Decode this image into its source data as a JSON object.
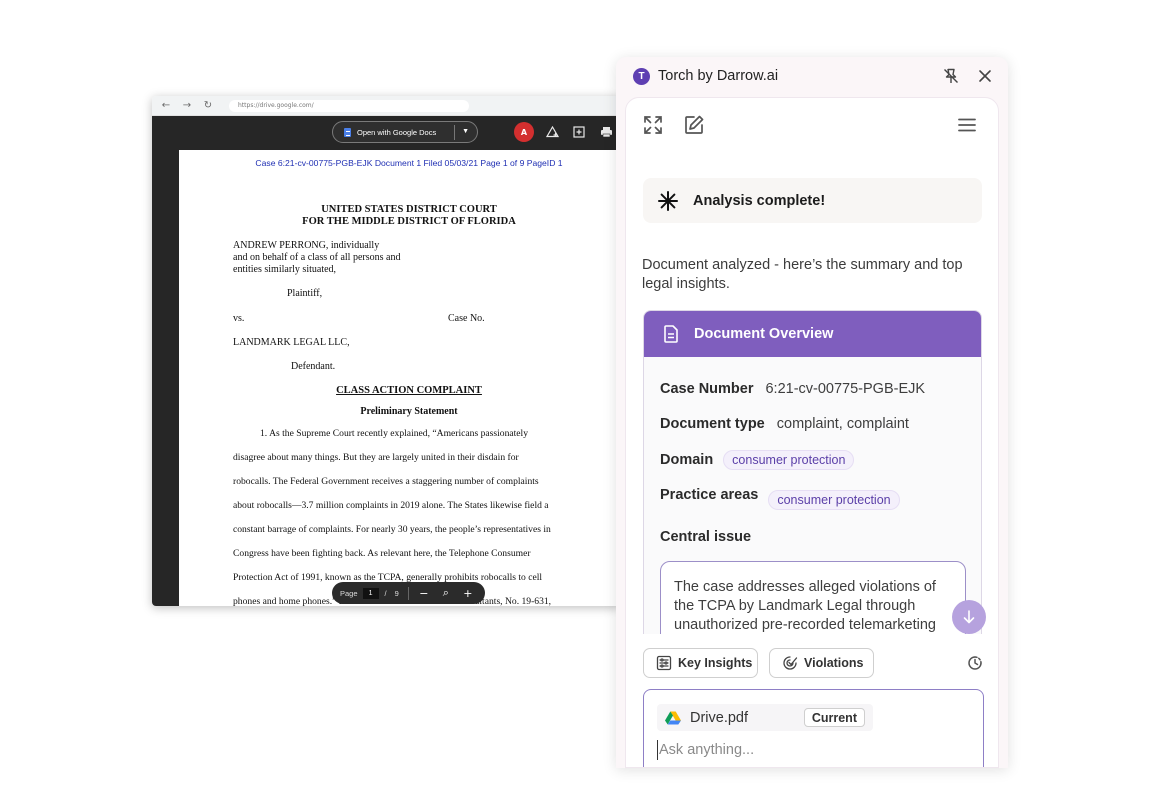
{
  "browser": {
    "url": "https://drive.google.com/",
    "nav": {
      "back": "←",
      "forward": "→",
      "reload": "↻"
    },
    "open_with_label": "Open with Google Docs"
  },
  "pdf": {
    "header_line": "Case 6:21-cv-00775-PGB-EJK   Document 1   Filed 05/03/21   Page 1 of 9 PageID 1",
    "court_line1": "UNITED STATES DISTRICT COURT",
    "court_line2": "FOR THE MIDDLE DISTRICT OF FLORIDA",
    "plaintiff_lines": [
      "ANDREW PERRONG, individually",
      "and on behalf of a class of all persons and",
      "entities similarly situated,"
    ],
    "plaintiff_label": "Plaintiff,",
    "vs": "vs.",
    "case_no": "Case No.",
    "defendant_name": "LANDMARK LEGAL LLC,",
    "defendant_label": "Defendant.",
    "complaint_title": "CLASS ACTION COMPLAINT",
    "prelim_title": "Preliminary Statement",
    "body_lines": [
      "1.       As the Supreme Court recently explained, “Americans passionately",
      "disagree about many things. But they are largely united in their disdain for",
      "robocalls. The Federal Government receives a staggering number of complaints",
      "about robocalls—3.7 million complaints in 2019 alone. The States likewise field a",
      "constant barrage of complaints. For nearly 30 years, the people’s representatives in",
      "Congress have been fighting back. As relevant here, the Telephone Consumer",
      "Protection Act of 1991, known as the TCPA, generally prohibits robocalls to cell",
      "phones and home phones.” Barr v. Am. Ass’n of Political Consultants, No. 19-631,"
    ],
    "pager": {
      "label": "Page",
      "current": "1",
      "slash": "/",
      "total": "9",
      "minus": "−",
      "zoom": "⌕",
      "plus": "+"
    }
  },
  "panel": {
    "title": "Torch by Darrow.ai",
    "logo_letter": "T",
    "analysis_status": "Analysis complete!",
    "intro": "Document analyzed - here’s the summary and top legal insights.",
    "overview": {
      "title": "Document Overview",
      "case_number_label": "Case Number",
      "case_number": "6:21-cv-00775-PGB-EJK",
      "doc_type_label": "Document type",
      "doc_type": "complaint, complaint",
      "domain_label": "Domain",
      "domain_tag": "consumer protection",
      "practice_label": "Practice areas",
      "practice_tag": "consumer protection",
      "central_issue_label": "Central issue",
      "central_issue": "The case addresses alleged violations of the TCPA by Landmark Legal through unauthorized pre-recorded telemarketing"
    },
    "chips": {
      "key_insights": "Key Insights",
      "violations": "Violations"
    },
    "composer": {
      "file_name": "Drive.pdf",
      "current_badge": "Current",
      "placeholder": "Ask anything..."
    },
    "colors": {
      "accent": "#7f5ebe",
      "logo": "#5e3fb2",
      "scroll_button": "#b6a2de"
    }
  }
}
